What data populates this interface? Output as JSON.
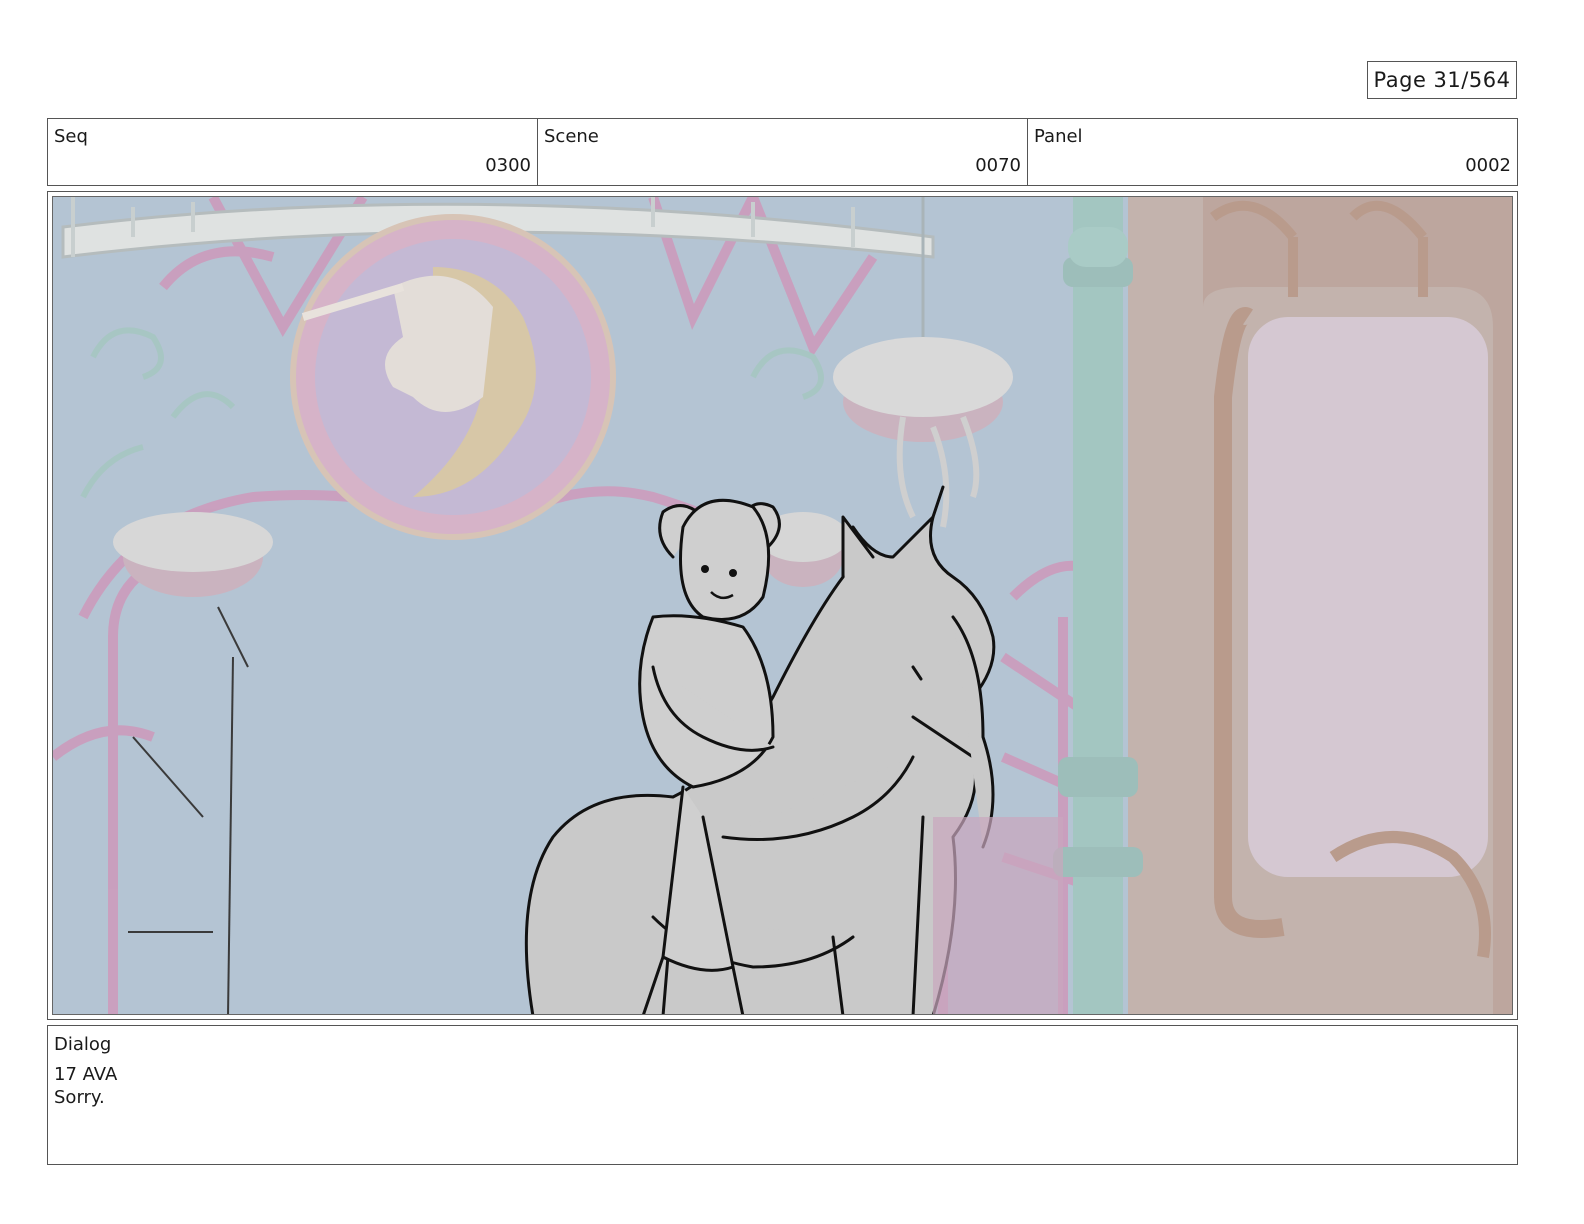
{
  "page": {
    "label": "Page 31/564"
  },
  "header": {
    "seq": {
      "label": "Seq",
      "value": "0300"
    },
    "scene": {
      "label": "Scene",
      "value": "0070"
    },
    "panel": {
      "label": "Panel",
      "value": "0002"
    }
  },
  "dialog": {
    "label": "Dialog",
    "lines": [
      "17 AVA",
      "Sorry."
    ]
  }
}
